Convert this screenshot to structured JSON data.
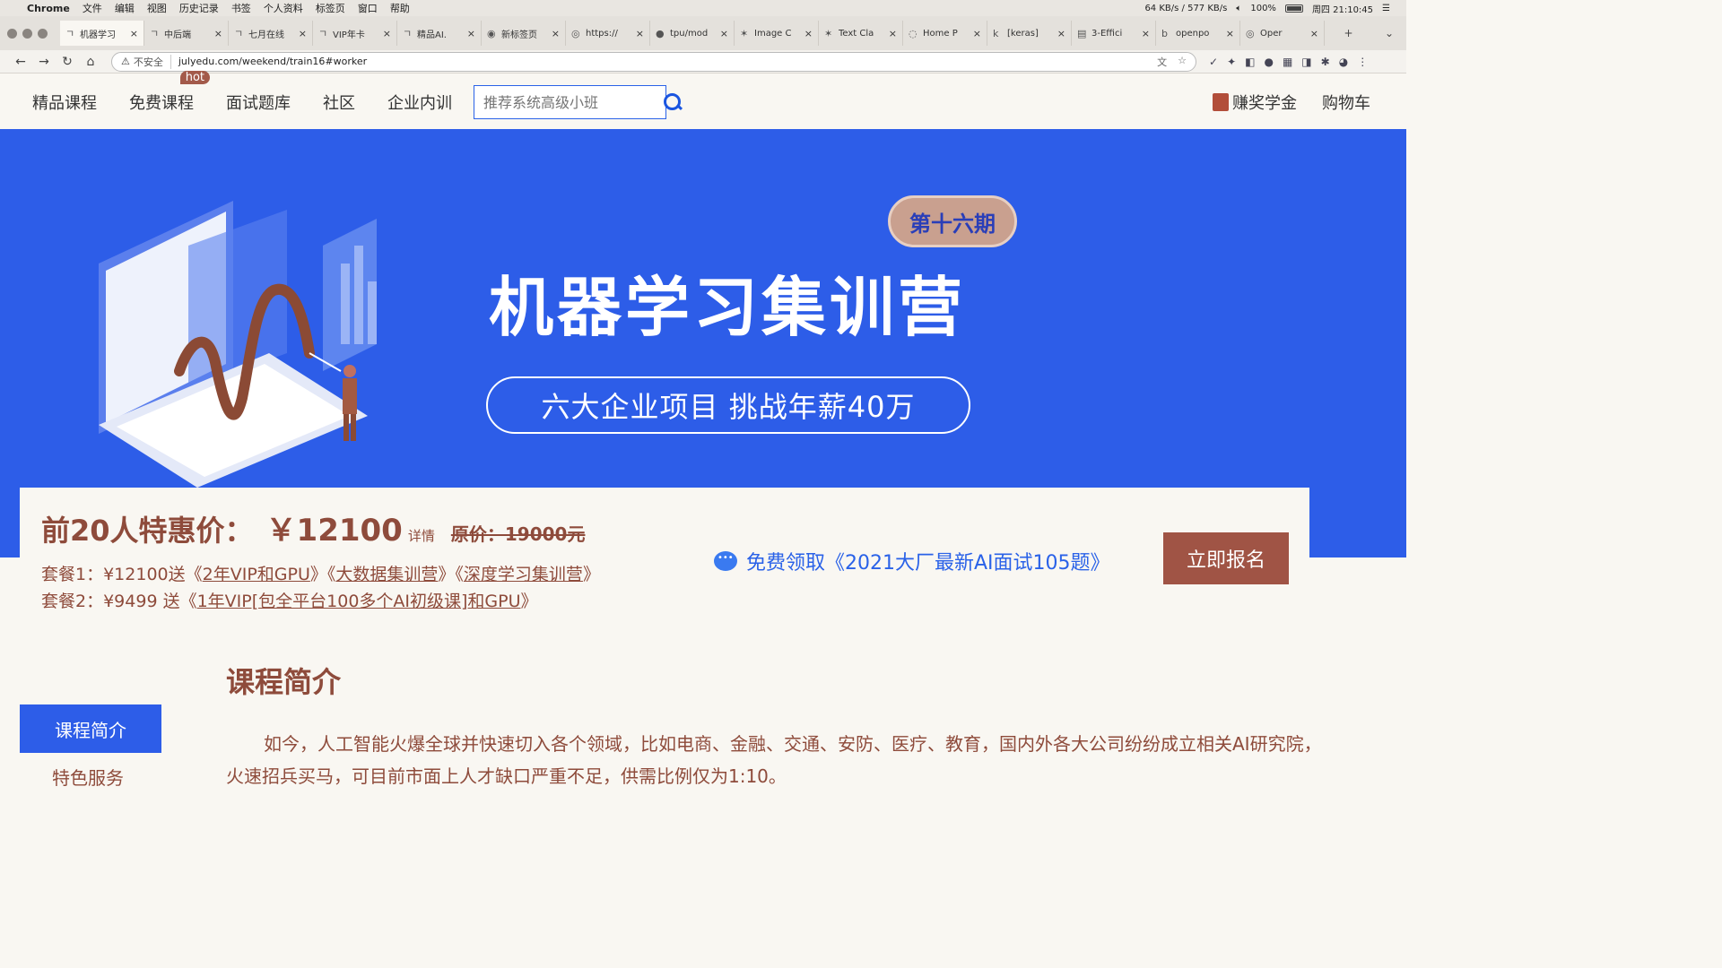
{
  "macos_menubar": {
    "app": "Chrome",
    "items": [
      "文件",
      "编辑",
      "视图",
      "历史记录",
      "书签",
      "个人资料",
      "标签页",
      "窗口",
      "帮助"
    ],
    "battery": "100%",
    "clock": "周四 21:10:45",
    "network_up": "64 KB/s",
    "network_down": "577 KB/s"
  },
  "browser": {
    "tabs": [
      {
        "title": "机器学习",
        "icon": "julyedu-icon"
      },
      {
        "title": "中后端",
        "icon": "julyedu-icon"
      },
      {
        "title": "七月在线",
        "icon": "julyedu-icon"
      },
      {
        "title": "VIP年卡",
        "icon": "julyedu-icon"
      },
      {
        "title": "精品AI.",
        "icon": "julyedu-icon"
      },
      {
        "title": "新标签页",
        "icon": "chrome-icon"
      },
      {
        "title": "https://",
        "icon": "globe-icon"
      },
      {
        "title": "tpu/mod",
        "icon": "github-icon"
      },
      {
        "title": "Image C",
        "icon": "fish-icon"
      },
      {
        "title": "Text Cla",
        "icon": "fish-icon"
      },
      {
        "title": "Home P",
        "icon": "loading-icon"
      },
      {
        "title": "[keras]",
        "icon": "k-icon"
      },
      {
        "title": "3-Effici",
        "icon": "doc-icon"
      },
      {
        "title": "openpo",
        "icon": "b-icon"
      },
      {
        "title": "Oper",
        "icon": "globe-icon"
      }
    ],
    "address": {
      "insecure_label": "不安全",
      "url": "julyedu.com/weekend/train16#worker"
    }
  },
  "site_nav": {
    "links": [
      "精品课程",
      "免费课程",
      "面试题库",
      "社区",
      "企业内训"
    ],
    "hot_badge": "hot",
    "search_placeholder": "推荐系统高级小班",
    "right_links": [
      "赚奖学金",
      "购物车"
    ]
  },
  "hero": {
    "period_badge": "第十六期",
    "title": "机器学习集训营",
    "subtitle": "六大企业项目  挑战年薪40万"
  },
  "pricing": {
    "label": "前20人特惠价：",
    "price": "￥12100",
    "detail": "详情",
    "original": "原价：19000元",
    "package1_prefix": "套餐1：¥12100送《",
    "package1_item1": "2年VIP和GPU",
    "package1_mid1": "》《",
    "package1_item2": "大数据集训营",
    "package1_mid2": "》《",
    "package1_item3": "深度学习集训营",
    "package1_suffix": "》",
    "package2_prefix": "套餐2：¥9499 送《",
    "package2_item": "1年VIP[包全平台100多个AI初级课]和GPU",
    "package2_suffix": "》",
    "free_offer": "免费领取《2021大厂最新AI面试105题》",
    "signup_button": "立即报名"
  },
  "course_intro": {
    "section_title": "课程简介",
    "side_nav_active": "课程简介",
    "side_nav_item": "特色服务",
    "paragraph": "如今，人工智能火爆全球并快速切入各个领域，比如电商、金融、交通、安防、医疗、教育，国内外各大公司纷纷成立相关AI研究院，火速招兵买马，可目前市面上人才缺口严重不足，供需比例仅为1:10。"
  },
  "colors": {
    "hero_blue": "#2d5de8",
    "brand_brown": "#8e4b3b",
    "signup_brown": "#a05445",
    "link_blue": "#2a62e8"
  }
}
